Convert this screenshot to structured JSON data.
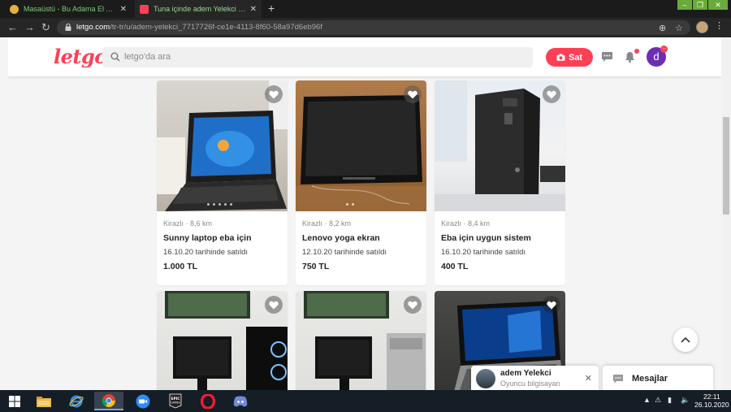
{
  "browser": {
    "tabs": [
      {
        "title": "Masaüstü - Bu Adama El Atın | Sa",
        "active": false
      },
      {
        "title": "Tuna içinde adem Yelekci - letgo",
        "active": true
      }
    ],
    "url_host": "letgo.com",
    "url_path": "/tr-tr/u/adem-yelekci_7717726f-ce1e-4113-8f60-58a97d6eb96f"
  },
  "header": {
    "logo": "letgo",
    "search_placeholder": "letgo'da ara",
    "sell_label": "Sat",
    "avatar_letter": "d",
    "brand_color": "#ff3f55",
    "avatar_color": "#6b2fb3"
  },
  "listings": [
    {
      "meta": "Kirazlı · 8,6 km",
      "title": "Sunny laptop eba için",
      "sold": "16.10.20 tarihinde satıldı",
      "price": "1.000 TL",
      "photo": "laptop"
    },
    {
      "meta": "Kirazlı · 8,2 km",
      "title": "Lenovo yoga ekran",
      "sold": "12.10.20 tarihinde satıldı",
      "price": "750 TL",
      "photo": "lenovo"
    },
    {
      "meta": "Kirazlı · 8,4 km",
      "title": "Eba için uygun sistem",
      "sold": "16.10.20 tarihinde satıldı",
      "price": "400 TL",
      "photo": "desktop-pc"
    },
    {
      "photo": "monitor-pc"
    },
    {
      "photo": "monitor-pc"
    },
    {
      "photo": "laptop-windows10"
    }
  ],
  "chat": {
    "name": "adem Yelekci",
    "status": "Oyuncu bilgisayarı",
    "messages_label": "Mesajlar"
  },
  "taskbar": {
    "apps": [
      "start-icon",
      "file-explorer-icon",
      "internet-explorer-icon",
      "chrome-icon",
      "zoom-icon",
      "epic-games-icon",
      "opera-icon",
      "discord-icon"
    ],
    "epic_label": "EPIC GAMES",
    "time": "22:11",
    "date": "26.10.2020"
  }
}
